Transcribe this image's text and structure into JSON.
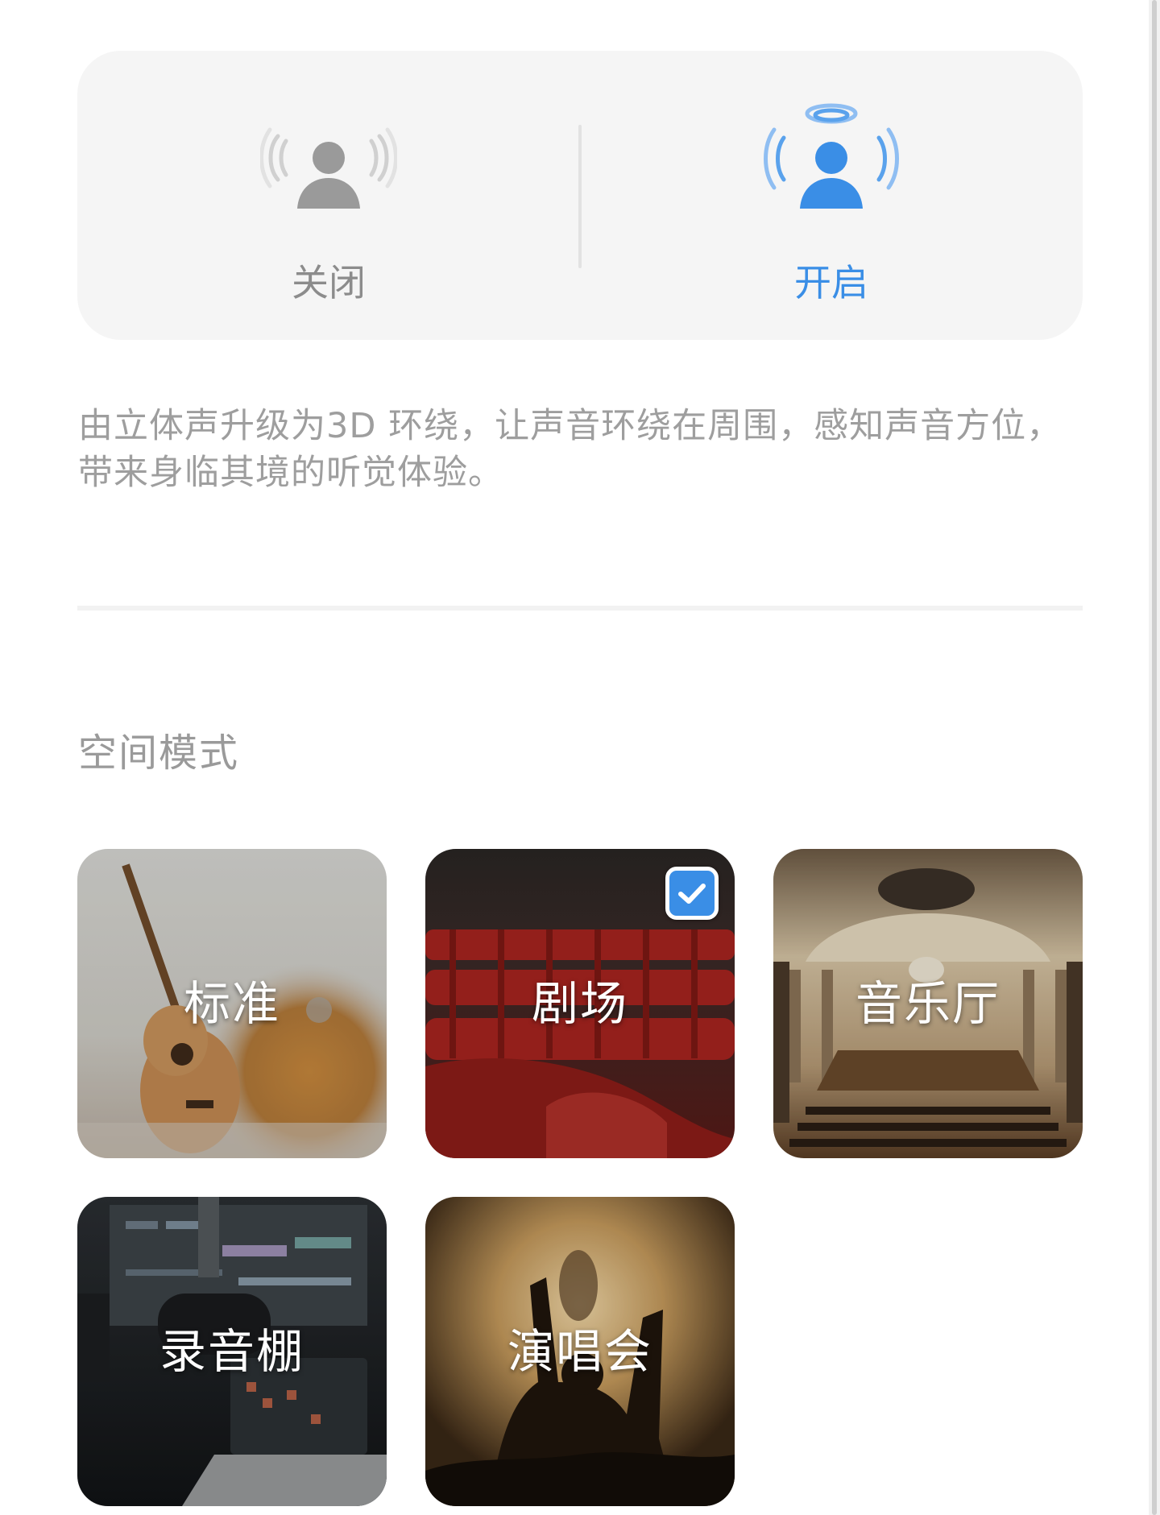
{
  "spatial_audio_toggle": {
    "off": {
      "label": "关闭",
      "icon": "spatial-audio-off-icon",
      "color": "#9e9e9e"
    },
    "on": {
      "label": "开启",
      "icon": "spatial-audio-on-icon",
      "color": "#3a8ee6"
    },
    "selected": "on"
  },
  "description": "由立体声升级为3D 环绕，让声音环绕在周围，感知声音方位，带来身临其境的听觉体验。",
  "space_mode": {
    "title": "空间模式",
    "modes": [
      {
        "label": "标准",
        "selected": false
      },
      {
        "label": "剧场",
        "selected": true
      },
      {
        "label": "音乐厅",
        "selected": false
      },
      {
        "label": "录音棚",
        "selected": false
      },
      {
        "label": "演唱会",
        "selected": false
      }
    ],
    "check_icon": "checkmark-icon"
  },
  "colors": {
    "accent": "#3a8ee6",
    "card_background": "#f5f5f5",
    "muted_text": "#9e9e9e"
  }
}
